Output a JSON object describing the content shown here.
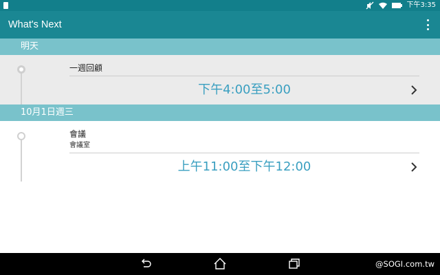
{
  "status_bar": {
    "time": "下午3:35"
  },
  "app_bar": {
    "title": "What's Next",
    "overflow_icon": "more-vert-icon"
  },
  "sections": [
    {
      "header": "明天",
      "events": [
        {
          "title": "一週回顧",
          "location": "",
          "time": "下午4:00至5:00"
        }
      ]
    },
    {
      "header": "10月1日週三",
      "events": [
        {
          "title": "會議",
          "location": "會議室",
          "time": "上午11:00至下午12:00"
        }
      ]
    }
  ],
  "nav_bar": {
    "icons": [
      "back-icon",
      "home-icon",
      "recent-apps-icon"
    ],
    "watermark": "@SOGI.com.tw"
  },
  "colors": {
    "status_bar": "#127f8b",
    "app_bar": "#1a8793",
    "section_header": "#79c2cb",
    "time_text": "#3a9fc0"
  }
}
